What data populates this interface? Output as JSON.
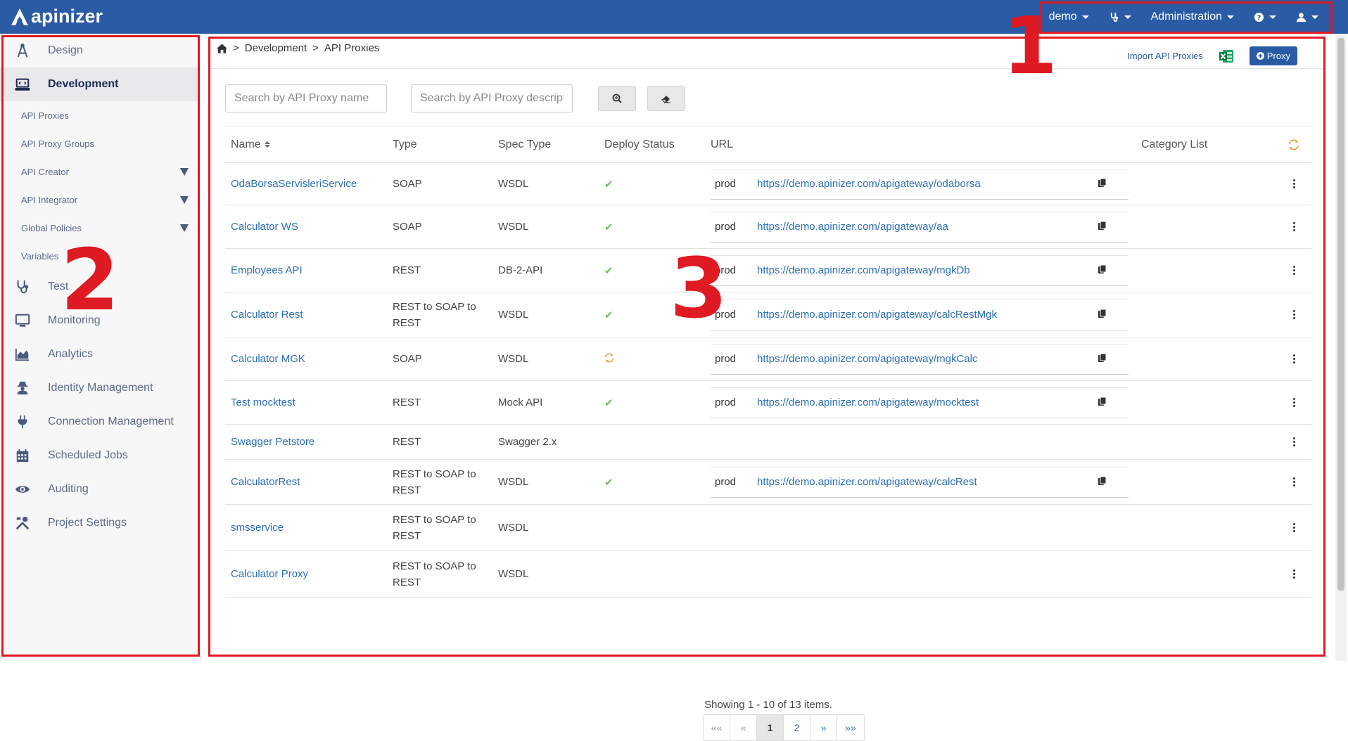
{
  "app": {
    "logo_text": "apinizer"
  },
  "topnav": {
    "items": [
      {
        "label": "demo",
        "icon": ""
      },
      {
        "label": "",
        "icon": "stethoscope-icon"
      },
      {
        "label": "Administration",
        "icon": ""
      },
      {
        "label": "",
        "icon": "question-circle-icon"
      },
      {
        "label": "",
        "icon": "user-icon"
      }
    ]
  },
  "sidebar": {
    "items": [
      {
        "label": "Design",
        "icon": "compass-drafting-icon"
      },
      {
        "label": "Development",
        "icon": "laptop-code-icon",
        "active": true
      },
      {
        "label": "Test",
        "icon": "stethoscope-icon"
      },
      {
        "label": "Monitoring",
        "icon": "desktop-icon"
      },
      {
        "label": "Analytics",
        "icon": "area-chart-icon"
      },
      {
        "label": "Identity Management",
        "icon": "user-secret-icon"
      },
      {
        "label": "Connection Management",
        "icon": "plug-icon"
      },
      {
        "label": "Scheduled Jobs",
        "icon": "calendar-icon"
      },
      {
        "label": "Auditing",
        "icon": "eye-icon"
      },
      {
        "label": "Project Settings",
        "icon": "tools-icon"
      }
    ],
    "sub_items": [
      {
        "label": "API Proxies",
        "expandable": false
      },
      {
        "label": "API Proxy Groups",
        "expandable": false
      },
      {
        "label": "API Creator",
        "expandable": true
      },
      {
        "label": "API Integrator",
        "expandable": true
      },
      {
        "label": "Global Policies",
        "expandable": true
      },
      {
        "label": "Variables",
        "expandable": false
      }
    ]
  },
  "breadcrumb": {
    "home_icon": "home-icon",
    "items": [
      "Development",
      "API Proxies"
    ],
    "separator": ">"
  },
  "actions": {
    "import_label": "Import API Proxies",
    "excel_icon": "excel-icon",
    "proxy_button": "Proxy"
  },
  "filters": {
    "name_placeholder": "Search by API Proxy name",
    "desc_placeholder": "Search by API Proxy description",
    "search_icon": "search-plus-icon",
    "clear_icon": "eraser-icon"
  },
  "table": {
    "headers": {
      "name": "Name",
      "type": "Type",
      "spec": "Spec Type",
      "deploy": "Deploy Status",
      "url": "URL",
      "category": "Category List"
    },
    "rows": [
      {
        "name": "OdaBorsaServisleriService",
        "type": "SOAP",
        "spec": "WSDL",
        "deploy": "deployed",
        "env": "prod",
        "url": "https://demo.apinizer.com/apigateway/odaborsa"
      },
      {
        "name": "Calculator WS",
        "type": "SOAP",
        "spec": "WSDL",
        "deploy": "deployed",
        "env": "prod",
        "url": "https://demo.apinizer.com/apigateway/aa"
      },
      {
        "name": "Employees API",
        "type": "REST",
        "spec": "DB-2-API",
        "deploy": "deployed",
        "env": "prod",
        "url": "https://demo.apinizer.com/apigateway/mgkDb"
      },
      {
        "name": "Calculator Rest",
        "type": "REST to SOAP to REST",
        "spec": "WSDL",
        "deploy": "deployed",
        "env": "prod",
        "url": "https://demo.apinizer.com/apigateway/calcRestMgk"
      },
      {
        "name": "Calculator MGK",
        "type": "SOAP",
        "spec": "WSDL",
        "deploy": "syncing",
        "env": "prod",
        "url": "https://demo.apinizer.com/apigateway/mgkCalc"
      },
      {
        "name": "Test mocktest",
        "type": "REST",
        "spec": "Mock API",
        "deploy": "deployed",
        "env": "prod",
        "url": "https://demo.apinizer.com/apigateway/mocktest"
      },
      {
        "name": "Swagger Petstore",
        "type": "REST",
        "spec": "Swagger 2.x",
        "deploy": "",
        "env": "",
        "url": ""
      },
      {
        "name": "CalculatorRest",
        "type": "REST to SOAP to REST",
        "spec": "WSDL",
        "deploy": "deployed",
        "env": "prod",
        "url": "https://demo.apinizer.com/apigateway/calcRest"
      },
      {
        "name": "smsservice",
        "type": "REST to SOAP to REST",
        "spec": "WSDL",
        "deploy": "",
        "env": "",
        "url": ""
      },
      {
        "name": "Calculator Proxy",
        "type": "REST to SOAP to REST",
        "spec": "WSDL",
        "deploy": "",
        "env": "",
        "url": ""
      }
    ]
  },
  "pagination": {
    "summary": "Showing 1 - 10 of 13 items.",
    "buttons": [
      "««",
      "«",
      "1",
      "2",
      "»",
      "»»"
    ],
    "current": "1"
  },
  "annotations": [
    "1",
    "2",
    "3"
  ],
  "colors": {
    "brand": "#2a5ba4",
    "annotation": "#e01a22",
    "link": "#2a6fb8",
    "deployed": "#6cbf5a",
    "syncing": "#e8a33d"
  }
}
